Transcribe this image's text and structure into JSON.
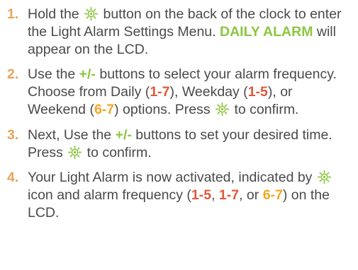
{
  "colors": {
    "text": "#4a4a4a",
    "step_number": "#e8a45a",
    "green_highlight": "#8cc63f",
    "red_highlight": "#e0593b",
    "orange_highlight": "#f5a623",
    "sun_icon": "#8cc63f"
  },
  "icon": "sun-icon",
  "steps": [
    {
      "number": "1.",
      "parts": {
        "a": "Hold the ",
        "b": " button on the back of the clock to enter the Light Alarm Settings Menu. ",
        "c": "DAILY ALARM",
        "d": " will appear on the LCD."
      }
    },
    {
      "number": "2.",
      "parts": {
        "a": "Use the ",
        "b": "+/-",
        "c": " buttons to select your alarm frequency. Choose from Daily (",
        "d": "1-7",
        "e": "), Weekday (",
        "f": "1-5",
        "g": "), or Weekend (",
        "h": "6-7",
        "i": ") options. Press ",
        "j": " to confirm."
      }
    },
    {
      "number": "3.",
      "parts": {
        "a": "Next, Use the ",
        "b": "+/-",
        "c": " buttons to set your desired time. Press ",
        "d": " to confirm."
      }
    },
    {
      "number": "4.",
      "parts": {
        "a": "Your Light Alarm is now activated, indicated by ",
        "b": " icon and alarm frequency (",
        "c": "1-5",
        "d": ", ",
        "e": "1-7",
        "f": ", or ",
        "g": "6-7",
        "h": ") on the LCD."
      }
    }
  ]
}
